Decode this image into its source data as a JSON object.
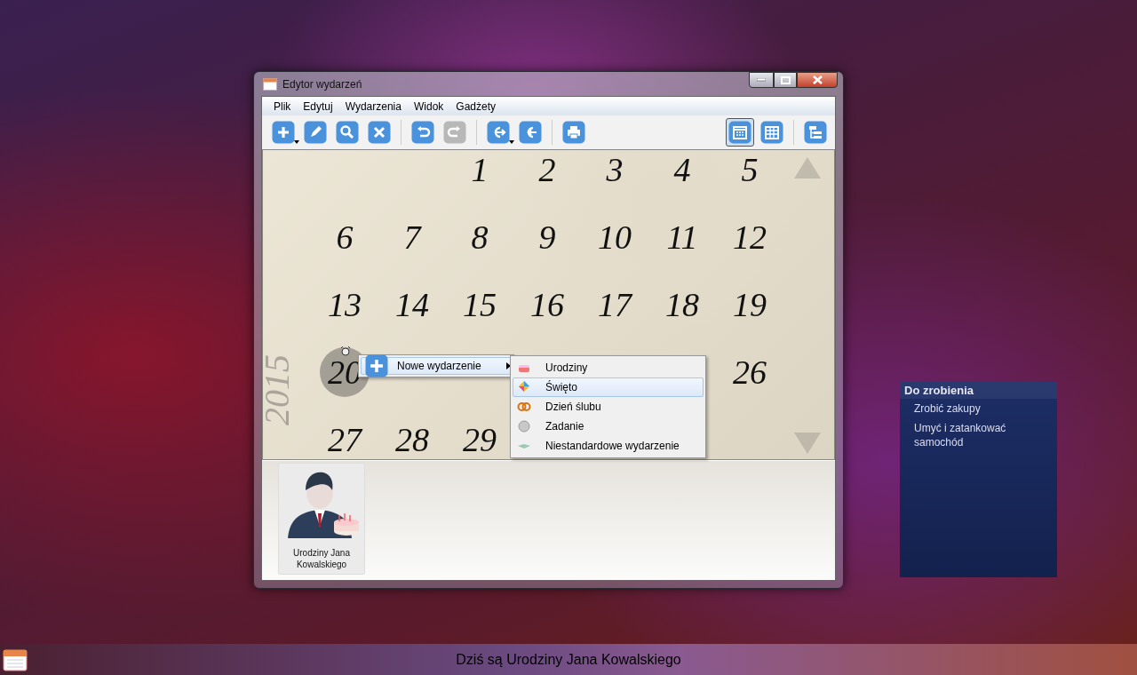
{
  "window": {
    "title": "Edytor wydarzeń"
  },
  "menu_bar": [
    "Plik",
    "Edytuj",
    "Wydarzenia",
    "Widok",
    "Gadżety"
  ],
  "toolbar": {
    "groups": [
      [
        {
          "dropdown": true,
          "disabled": false
        },
        {
          "dropdown": false,
          "disabled": false
        },
        {
          "dropdown": false,
          "disabled": false
        },
        {
          "dropdown": false,
          "disabled": false
        }
      ],
      [
        {
          "dropdown": false,
          "disabled": false
        },
        {
          "dropdown": false,
          "disabled": true
        }
      ],
      [
        {
          "dropdown": true,
          "disabled": false
        },
        {
          "dropdown": false,
          "disabled": false
        }
      ],
      [
        {
          "dropdown": false,
          "disabled": false
        }
      ]
    ],
    "views": [
      {
        "selected": true
      },
      {
        "selected": false
      }
    ],
    "extra": [
      {
        "selected": false
      }
    ]
  },
  "calendar": {
    "year": "2015",
    "days": [
      {
        "day": "1",
        "selected": false,
        "alarm": false
      },
      {
        "day": "2",
        "selected": false,
        "alarm": false
      },
      {
        "day": "3",
        "selected": false,
        "alarm": false
      },
      {
        "day": "4",
        "selected": false,
        "alarm": false
      },
      {
        "day": "5",
        "selected": false,
        "alarm": false
      },
      {
        "day": "6",
        "selected": false,
        "alarm": false
      },
      {
        "day": "7",
        "selected": false,
        "alarm": false
      },
      {
        "day": "8",
        "selected": false,
        "alarm": false
      },
      {
        "day": "9",
        "selected": false,
        "alarm": false
      },
      {
        "day": "10",
        "selected": false,
        "alarm": false
      },
      {
        "day": "11",
        "selected": false,
        "alarm": false
      },
      {
        "day": "12",
        "selected": false,
        "alarm": false
      },
      {
        "day": "13",
        "selected": false,
        "alarm": false
      },
      {
        "day": "14",
        "selected": false,
        "alarm": false
      },
      {
        "day": "15",
        "selected": false,
        "alarm": false
      },
      {
        "day": "16",
        "selected": false,
        "alarm": false
      },
      {
        "day": "17",
        "selected": false,
        "alarm": false
      },
      {
        "day": "18",
        "selected": false,
        "alarm": false
      },
      {
        "day": "19",
        "selected": false,
        "alarm": false
      },
      {
        "day": "20",
        "selected": true,
        "alarm": true
      },
      {
        "day": "26",
        "selected": false,
        "alarm": false
      },
      {
        "day": "27",
        "selected": false,
        "alarm": false
      },
      {
        "day": "28",
        "selected": false,
        "alarm": false
      },
      {
        "day": "29",
        "selected": false,
        "alarm": false
      }
    ]
  },
  "context_menu": {
    "items": [
      {
        "label": "Nowe wydarzenie",
        "selected": true,
        "submenu": true
      }
    ],
    "submenu": [
      {
        "kind": "birthday",
        "label": "Urodziny",
        "selected": false
      },
      {
        "kind": "holiday",
        "label": "Święto",
        "selected": true
      },
      {
        "kind": "wedding",
        "label": "Dzień ślubu",
        "selected": false
      },
      {
        "kind": "task",
        "label": "Zadanie",
        "selected": false
      },
      {
        "kind": "custom",
        "label": "Niestandardowe wydarzenie",
        "selected": false
      }
    ]
  },
  "events": [
    {
      "kind": "birthday",
      "label": "Urodziny Jana Kowalskiego"
    }
  ],
  "todo_gadget": {
    "title": "Do zrobienia",
    "items": [
      "Zrobić zakupy",
      "Umyć i zatankować samochód"
    ]
  },
  "status_bar": {
    "message": "Dziś są Urodziny Jana Kowalskiego"
  }
}
